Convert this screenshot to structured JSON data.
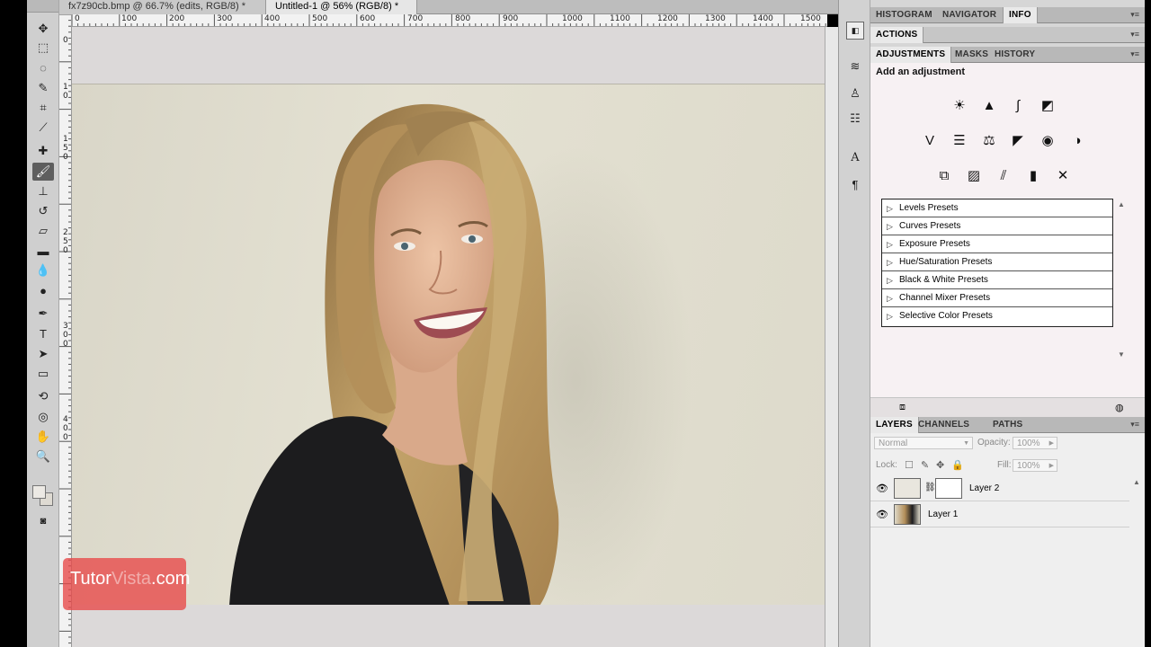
{
  "documents": {
    "tabs": [
      {
        "label": "fx7z90cb.bmp @ 66.7% (edits, RGB/8) *"
      },
      {
        "label": "Untitled-1 @ 56% (RGB/8) *"
      }
    ],
    "close_glyph": "×"
  },
  "ruler": {
    "top_labels": [
      "0",
      "100",
      "200",
      "300",
      "400",
      "500",
      "600",
      "700",
      "800",
      "900",
      "1000",
      "1100",
      "1200",
      "1300",
      "1400",
      "1500"
    ],
    "left_labels": [
      "0",
      "1",
      "0",
      "1",
      "5",
      "0",
      "2",
      "5",
      "0",
      "3",
      "0",
      "0",
      "4",
      "0",
      "0"
    ]
  },
  "tools": {
    "icons": [
      "move-tool-icon",
      "marquee-tool-icon",
      "lasso-tool-icon",
      "quick-select-tool-icon",
      "crop-tool-icon",
      "eyedropper-tool-icon",
      "healing-tool-icon",
      "brush-tool-icon",
      "clone-stamp-tool-icon",
      "history-brush-tool-icon",
      "eraser-tool-icon",
      "gradient-tool-icon",
      "blur-tool-icon",
      "dodge-tool-icon",
      "pen-tool-icon",
      "type-tool-icon",
      "path-select-tool-icon",
      "shape-tool-icon",
      "3d-rotate-tool-icon",
      "3d-orbit-tool-icon",
      "hand-tool-icon",
      "zoom-tool-icon"
    ],
    "active": "brush-tool-icon",
    "foreground_color": "#ece9e4",
    "background_color": "#dedad2"
  },
  "panels": {
    "top_tabs": [
      "HISTOGRAM",
      "NAVIGATOR",
      "INFO"
    ],
    "actions_tab": "ACTIONS",
    "adj_tabs": [
      "ADJUSTMENTS",
      "MASKS",
      "HISTORY"
    ],
    "adj_title": "Add an adjustment",
    "presets": [
      "Levels Presets",
      "Curves Presets",
      "Exposure Presets",
      "Hue/Saturation Presets",
      "Black & White Presets",
      "Channel Mixer Presets",
      "Selective Color Presets"
    ],
    "layer_tabs": [
      "LAYERS",
      "CHANNELS",
      "PATHS"
    ],
    "blend_mode": "Normal",
    "opacity_label": "Opacity:",
    "opacity_value": "100%",
    "lock_label": "Lock:",
    "fill_label": "Fill:",
    "fill_value": "100%",
    "layers": [
      {
        "name": "Layer 2"
      },
      {
        "name": "Layer 1"
      }
    ]
  },
  "watermark": {
    "text_a": "Tutor",
    "text_b": "Vista",
    "text_c": ".com"
  },
  "colors": {
    "accent_red": "#e84848",
    "active_tool": "#5e5e5e"
  }
}
